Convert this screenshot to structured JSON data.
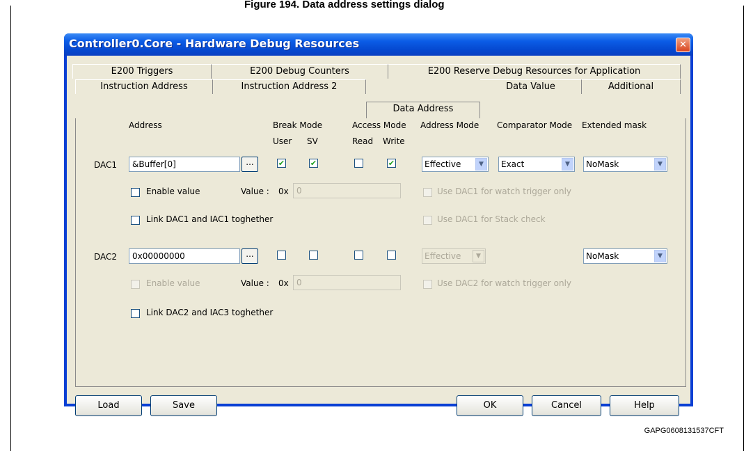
{
  "caption": "Figure 194. Data address settings dialog",
  "figure_id": "GAPG0608131537CFT",
  "dialog": {
    "title": "Controller0.Core - Hardware Debug Resources",
    "close_glyph": "✕",
    "tabs_row1": [
      "E200 Triggers",
      "E200 Debug Counters",
      "E200 Reserve Debug Resources for Application"
    ],
    "tabs_row2": [
      "Instruction Address",
      "Instruction Address 2",
      "Data Address",
      "Data Value",
      "Additional"
    ],
    "active_tab": "Data Address"
  },
  "headers": {
    "address": "Address",
    "break_mode": "Break Mode",
    "user": "User",
    "sv": "SV",
    "access_mode": "Access Mode",
    "read": "Read",
    "write": "Write",
    "address_mode": "Address Mode",
    "comparator_mode": "Comparator Mode",
    "extended_mask": "Extended mask"
  },
  "dac1": {
    "label": "DAC1",
    "address": "&Buffer[0]",
    "browse": "...",
    "user": true,
    "sv": true,
    "read": false,
    "write": true,
    "address_mode": "Effective",
    "comparator_mode": "Exact",
    "extended_mask": "NoMask",
    "enable_value": "Enable value",
    "value_label": "Value :",
    "value_prefix": "0x",
    "value": "0",
    "watch_trigger": "Use DAC1 for watch trigger only",
    "link": "Link DAC1 and IAC1 toghether",
    "stack_check": "Use DAC1 for Stack check"
  },
  "dac2": {
    "label": "DAC2",
    "address": "0x00000000",
    "browse": "...",
    "user": false,
    "sv": false,
    "read": false,
    "write": false,
    "address_mode": "Effective",
    "extended_mask": "NoMask",
    "enable_value": "Enable value",
    "value_label": "Value :",
    "value_prefix": "0x",
    "value": "0",
    "watch_trigger": "Use DAC2 for watch trigger only",
    "link": "Link DAC2 and IAC3 toghether"
  },
  "buttons": {
    "load": "Load",
    "save": "Save",
    "ok": "OK",
    "cancel": "Cancel",
    "help": "Help"
  },
  "check_glyph": "✔",
  "dropdown_glyph": "▼"
}
